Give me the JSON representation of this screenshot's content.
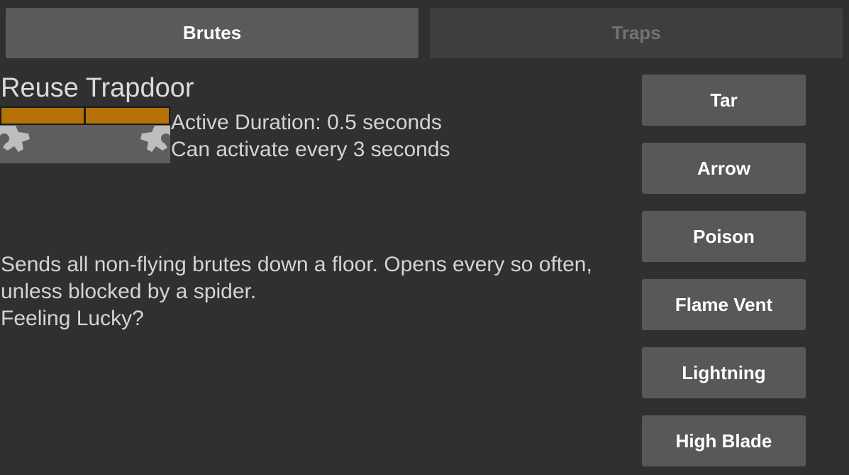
{
  "tabs": {
    "brutes": "Brutes",
    "traps": "Traps",
    "active": "brutes"
  },
  "detail": {
    "title": "Reuse Trapdoor",
    "icon": "trapdoor-with-gears-icon",
    "stats": [
      "Active Duration: 0.5 seconds",
      "Can activate every 3 seconds"
    ],
    "description": [
      "Sends all non-flying brutes down a floor. Opens every so often,",
      "unless blocked by a spider.",
      "Feeling Lucky?"
    ]
  },
  "trap_list": [
    {
      "label": "Tar"
    },
    {
      "label": "Arrow"
    },
    {
      "label": "Poison"
    },
    {
      "label": "Flame Vent"
    },
    {
      "label": "Lightning"
    },
    {
      "label": "High Blade"
    }
  ],
  "colors": {
    "background": "#303030",
    "tab_active": "#5a5a5a",
    "tab_inactive": "#3e3e3e",
    "button": "#585858",
    "trapdoor_wood": "#b57206",
    "trapdoor_pit": "#5e5e5e",
    "gear": "#bdbdbd"
  }
}
